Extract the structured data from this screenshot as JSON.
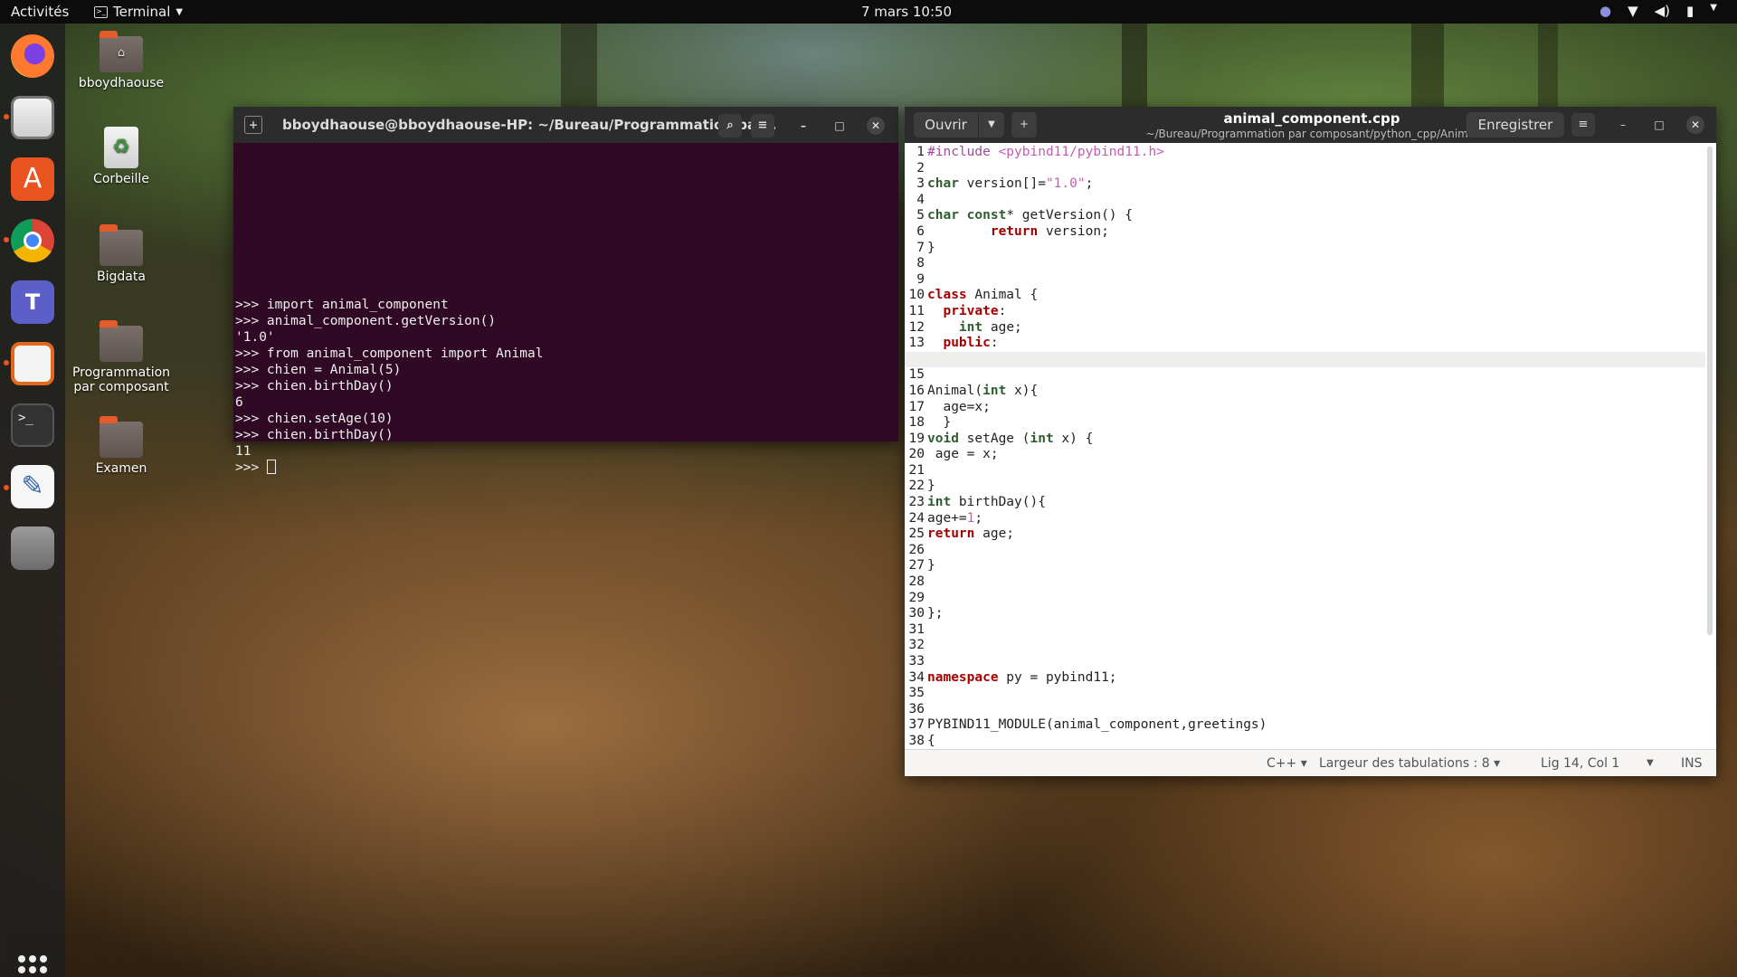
{
  "topbar": {
    "activities": "Activités",
    "app_name": "Terminal",
    "clock": "7 mars  10:50"
  },
  "desktop": {
    "icons": [
      "bboydhaouse",
      "Corbeille",
      "Bigdata",
      "Programmation par composant",
      "Examen"
    ]
  },
  "dock": {
    "apps": [
      "firefox-icon",
      "files-icon",
      "software-center-icon",
      "chrome-icon",
      "teams-icon",
      "impress-icon",
      "terminal-icon",
      "text-editor-icon",
      "drive-icon"
    ]
  },
  "terminal": {
    "title": "bboydhaouse@bboydhaouse-HP: ~/Bureau/Programmation par...",
    "lines": [
      ">>> import animal_component",
      ">>> animal_component.getVersion()",
      "'1.0'",
      ">>> from animal_component import Animal",
      ">>> chien = Animal(5)",
      ">>> chien.birthDay()",
      "6",
      ">>> chien.setAge(10)",
      ">>> chien.birthDay()",
      "11"
    ],
    "prompt": ">>> "
  },
  "editor": {
    "open_label": "Ouvrir",
    "save_label": "Enregistrer",
    "filename": "animal_component.cpp",
    "path": "~/Bureau/Programmation par composant/python_cpp/Animal",
    "current_line": 14,
    "status": {
      "language": "C++",
      "tab_width": "Largeur des tabulations : 8",
      "position": "Lig 14, Col 1",
      "mode": "INS"
    }
  },
  "colors": {
    "terminal_bg": "#300a24",
    "titlebar_bg": "#2c2c2c",
    "accent": "#e95420"
  }
}
